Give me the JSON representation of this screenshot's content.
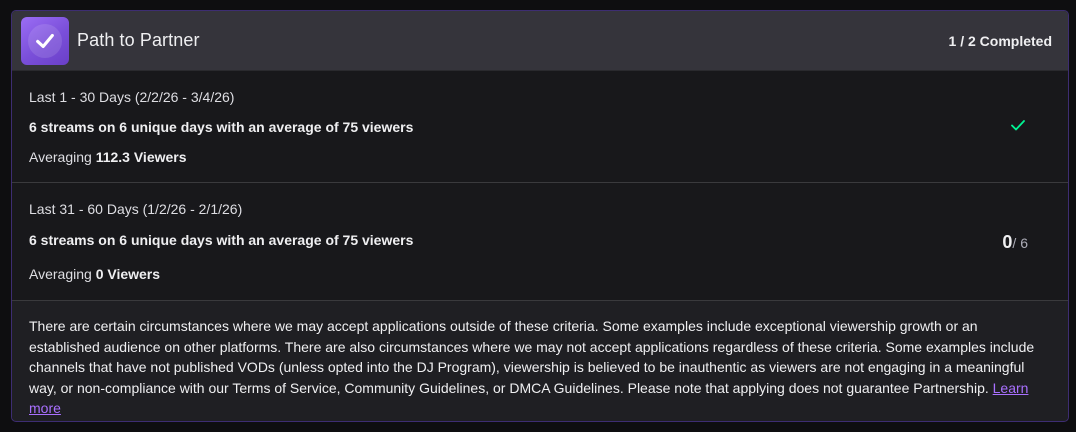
{
  "header": {
    "title": "Path to Partner",
    "status": "1 / 2 Completed",
    "badge_icon": "checkmark-badge-icon"
  },
  "sections": [
    {
      "range": "Last 1 - 30 Days (2/2/26 - 3/4/26)",
      "requirement": "6 streams on 6 unique days with an average of 75 viewers",
      "avg_prefix": "Averaging ",
      "avg_value": "112.3 Viewers",
      "status_icon": "check-icon",
      "status_color": "#00f593"
    },
    {
      "range": "Last 31 - 60 Days (1/2/26 - 2/1/26)",
      "requirement": "6 streams on 6 unique days with an average of 75 viewers",
      "avg_prefix": "Averaging ",
      "avg_value": "0 Viewers",
      "progress_current": "0",
      "progress_total": "/ 6"
    }
  ],
  "footer": {
    "text": "There are certain circumstances where we may accept applications outside of these criteria. Some examples include exceptional viewership growth or an established audience on other platforms. There are also circumstances where we may not accept applications regardless of these criteria. Some examples include channels that have not published VODs (unless opted into the DJ Program), viewership is believed to be inauthentic as viewers are not engaging in a meaningful way, or non-compliance with our Terms of Service, Community Guidelines, or DMCA Guidelines. Please note that applying does not guarantee Partnership. ",
    "link_label": "Learn more"
  },
  "colors": {
    "accent": "#a970ff",
    "success": "#00f593",
    "border": "#3d2d72"
  }
}
